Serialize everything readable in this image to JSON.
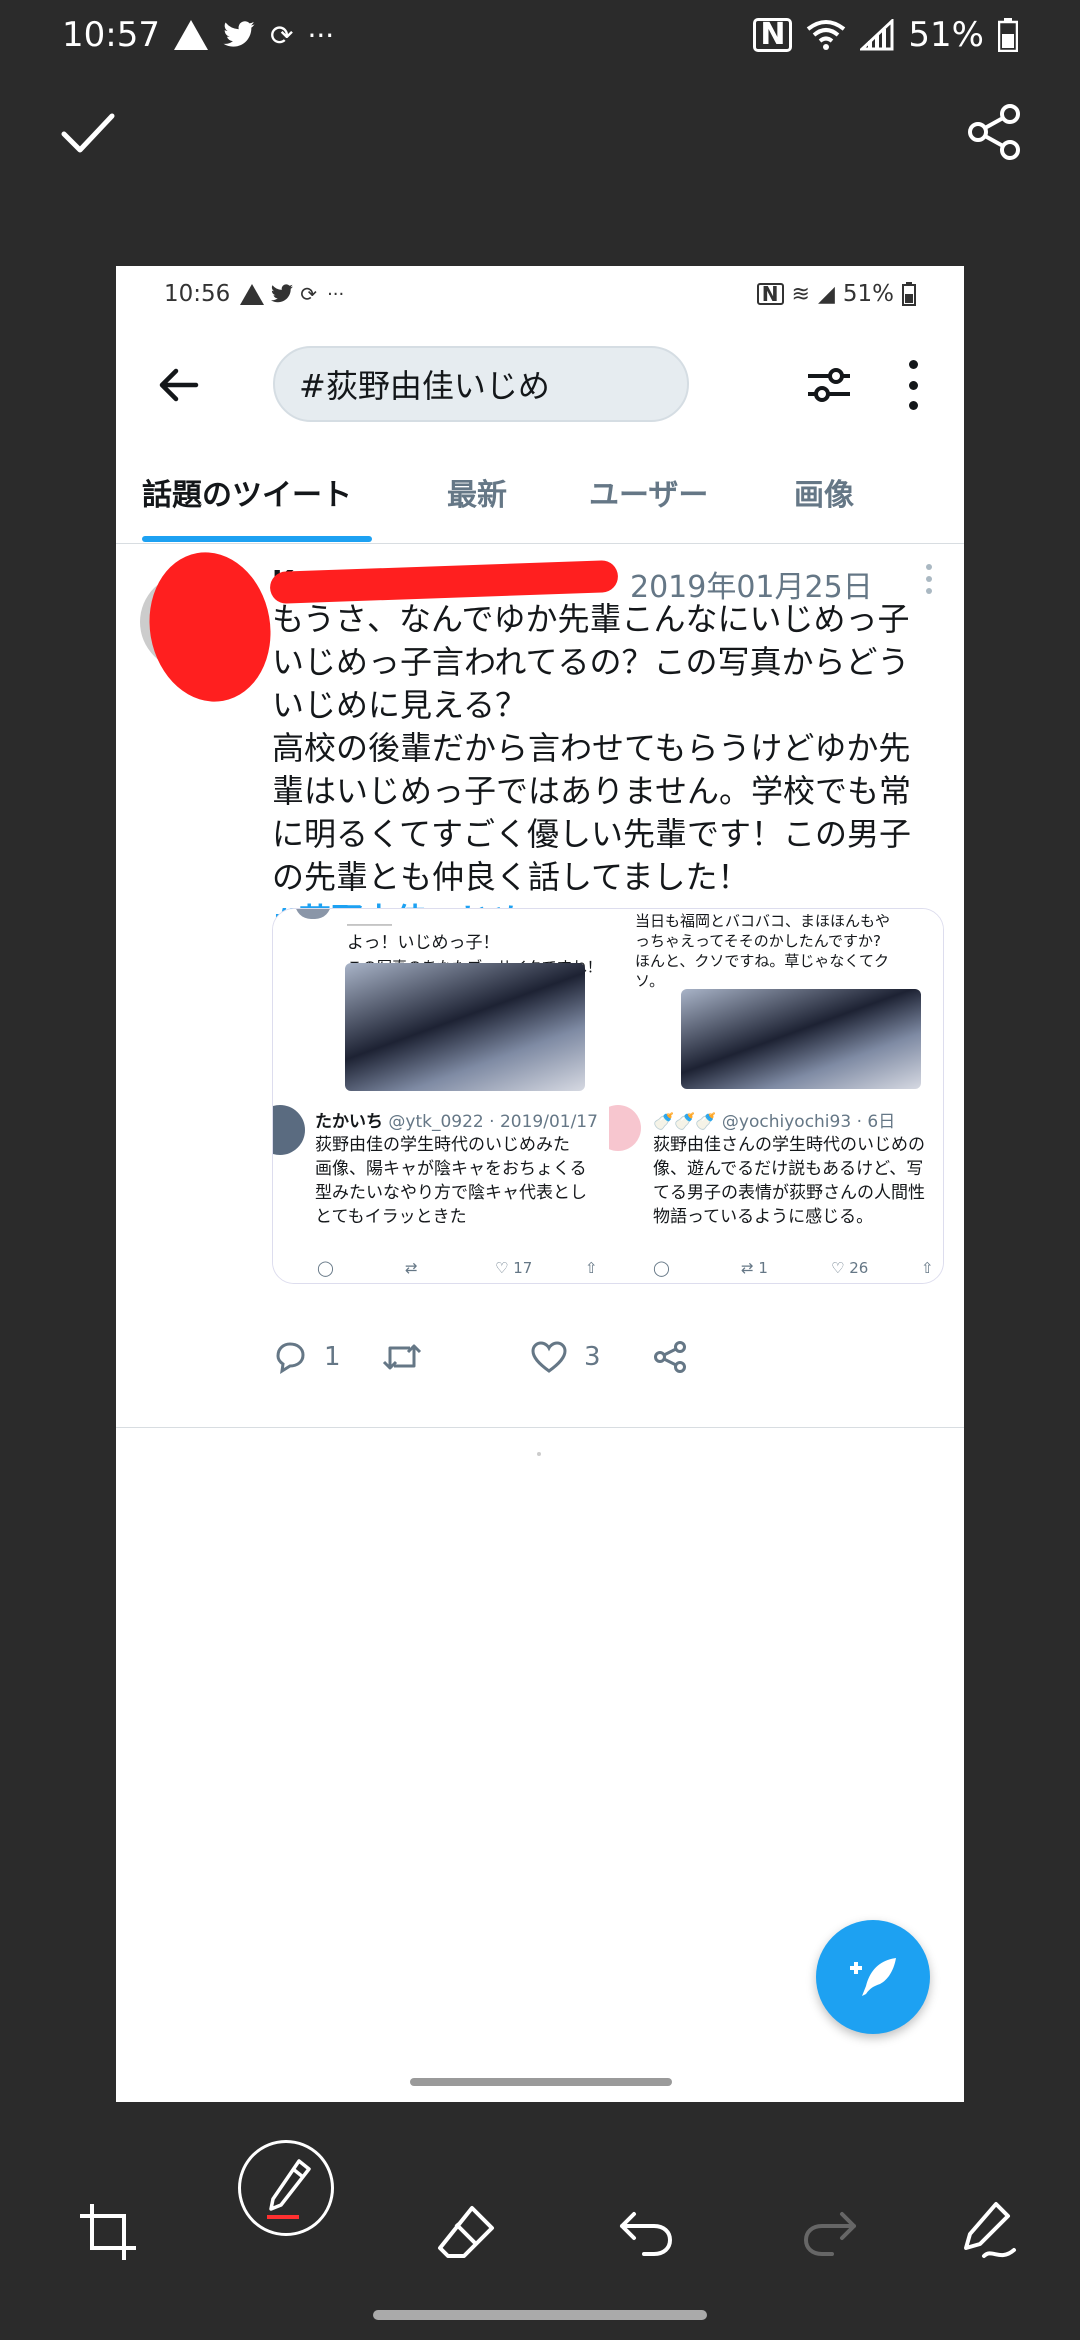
{
  "status": {
    "time": "10:57",
    "battery": "51%",
    "more": "···"
  },
  "inner_status": {
    "time": "10:56",
    "battery": "51%",
    "more": "···"
  },
  "search": {
    "query": "#荻野由佳いじめ"
  },
  "tabs": [
    "話題のツイート",
    "最新",
    "ユーザー",
    "画像"
  ],
  "tweet": {
    "name": "Ko",
    "date": "2019年01月25日",
    "lines": [
      "もうさ、なんでゆか先輩こんなにいじめっ子",
      "いじめっ子言われてるの？この写真からどう",
      "いじめに見える？",
      "高校の後輩だから言わせてもらうけどゆか先",
      "輩はいじめっ子ではありません。学校でも常",
      "に明るくてすごく優しい先輩です！この男子",
      "の先輩とも仲良く話してました！"
    ],
    "hashtag": "#荻野由佳いじめ",
    "replies": "1",
    "likes": "3"
  },
  "cards": {
    "q1": {
      "line1": "よっ！いじめっ子！",
      "line2": "この写真のあなたブッサイクですね！"
    },
    "q2": {
      "line1": "当日も福岡とバコバコ、まほほんもや",
      "line2": "っちゃえってそそのかしたんですか?",
      "line3": "ほんと、クソですね。草じゃなくてク",
      "line4": "ソ。"
    },
    "q3": {
      "name": "たかいち",
      "handle": "@ytk_0922 · 2019/01/17",
      "lines": [
        "荻野由佳の学生時代のいじめみた",
        "画像、陽キャが陰キャをおちょくる",
        "型みたいなやり方で陰キャ代表とし",
        "とてもイラッときた"
      ],
      "likes": "17"
    },
    "q4": {
      "name": "🍼🍼🍼",
      "handle": "@yochiyochi93 · 6日",
      "lines": [
        "荻野由佳さんの学生時代のいじめの",
        "像、遊んでるだけ説もあるけど、写",
        "てる男子の表情が荻野さんの人間性",
        "物語っているように感じる。"
      ],
      "retweets": "1",
      "likes": "26"
    }
  }
}
